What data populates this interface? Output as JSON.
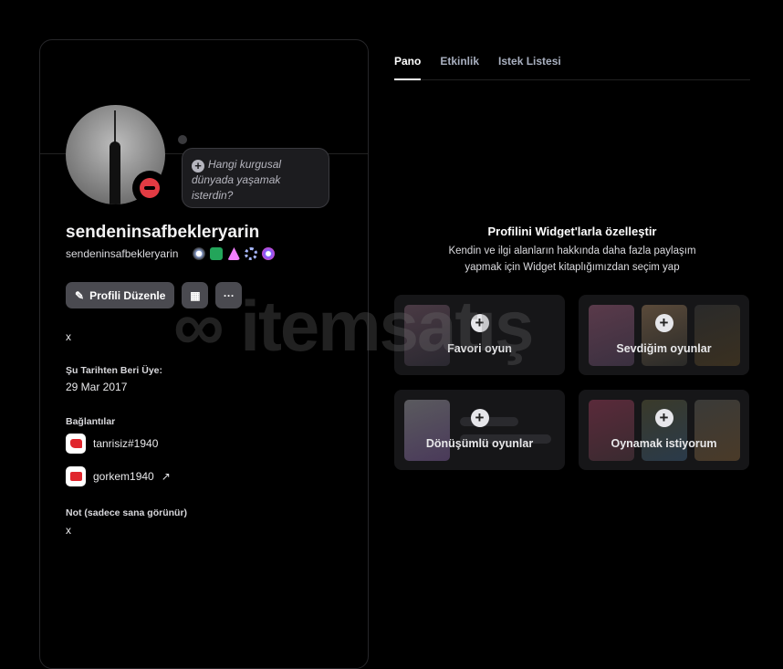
{
  "profile": {
    "bubble_text": "Hangi kurgusal dünyada yaşamak isterdin?",
    "display_name": "sendeninsafbekleryarin",
    "username": "sendeninsafbekleryarin",
    "edit_button": "Profili Düzenle",
    "more_button": "···",
    "bio": "x",
    "member_since_label": "Şu Tarihten Beri Üye:",
    "member_since": "29 Mar 2017",
    "connections_label": "Bağlantılar",
    "connections": [
      {
        "service": "riot-games",
        "name": "tanrisiz#1940"
      },
      {
        "service": "youtube",
        "name": "gorkem1940",
        "link": "↗"
      }
    ],
    "note_label": "Not (sadece sana görünür)",
    "note": "x"
  },
  "tabs": [
    {
      "label": "Pano",
      "active": true
    },
    {
      "label": "Etkinlik"
    },
    {
      "label": "Istek Listesi"
    }
  ],
  "widgets": {
    "title": "Profilini Widget'larla özelleştir",
    "subtitle_1": "Kendin ve ilgi alanların hakkında daha fazla paylaşım",
    "subtitle_2": "yapmak için Widget kitaplığımızdan seçim yap",
    "cards": [
      {
        "label": "Favori oyun"
      },
      {
        "label": "Sevdiğim oyunlar"
      },
      {
        "label": "Dönüşümlü oyunlar"
      },
      {
        "label": "Oynamak istiyorum"
      }
    ]
  },
  "watermark": "itemsatış",
  "colors": {
    "status_dnd": "#e23b43",
    "button": "#4a4a50"
  }
}
